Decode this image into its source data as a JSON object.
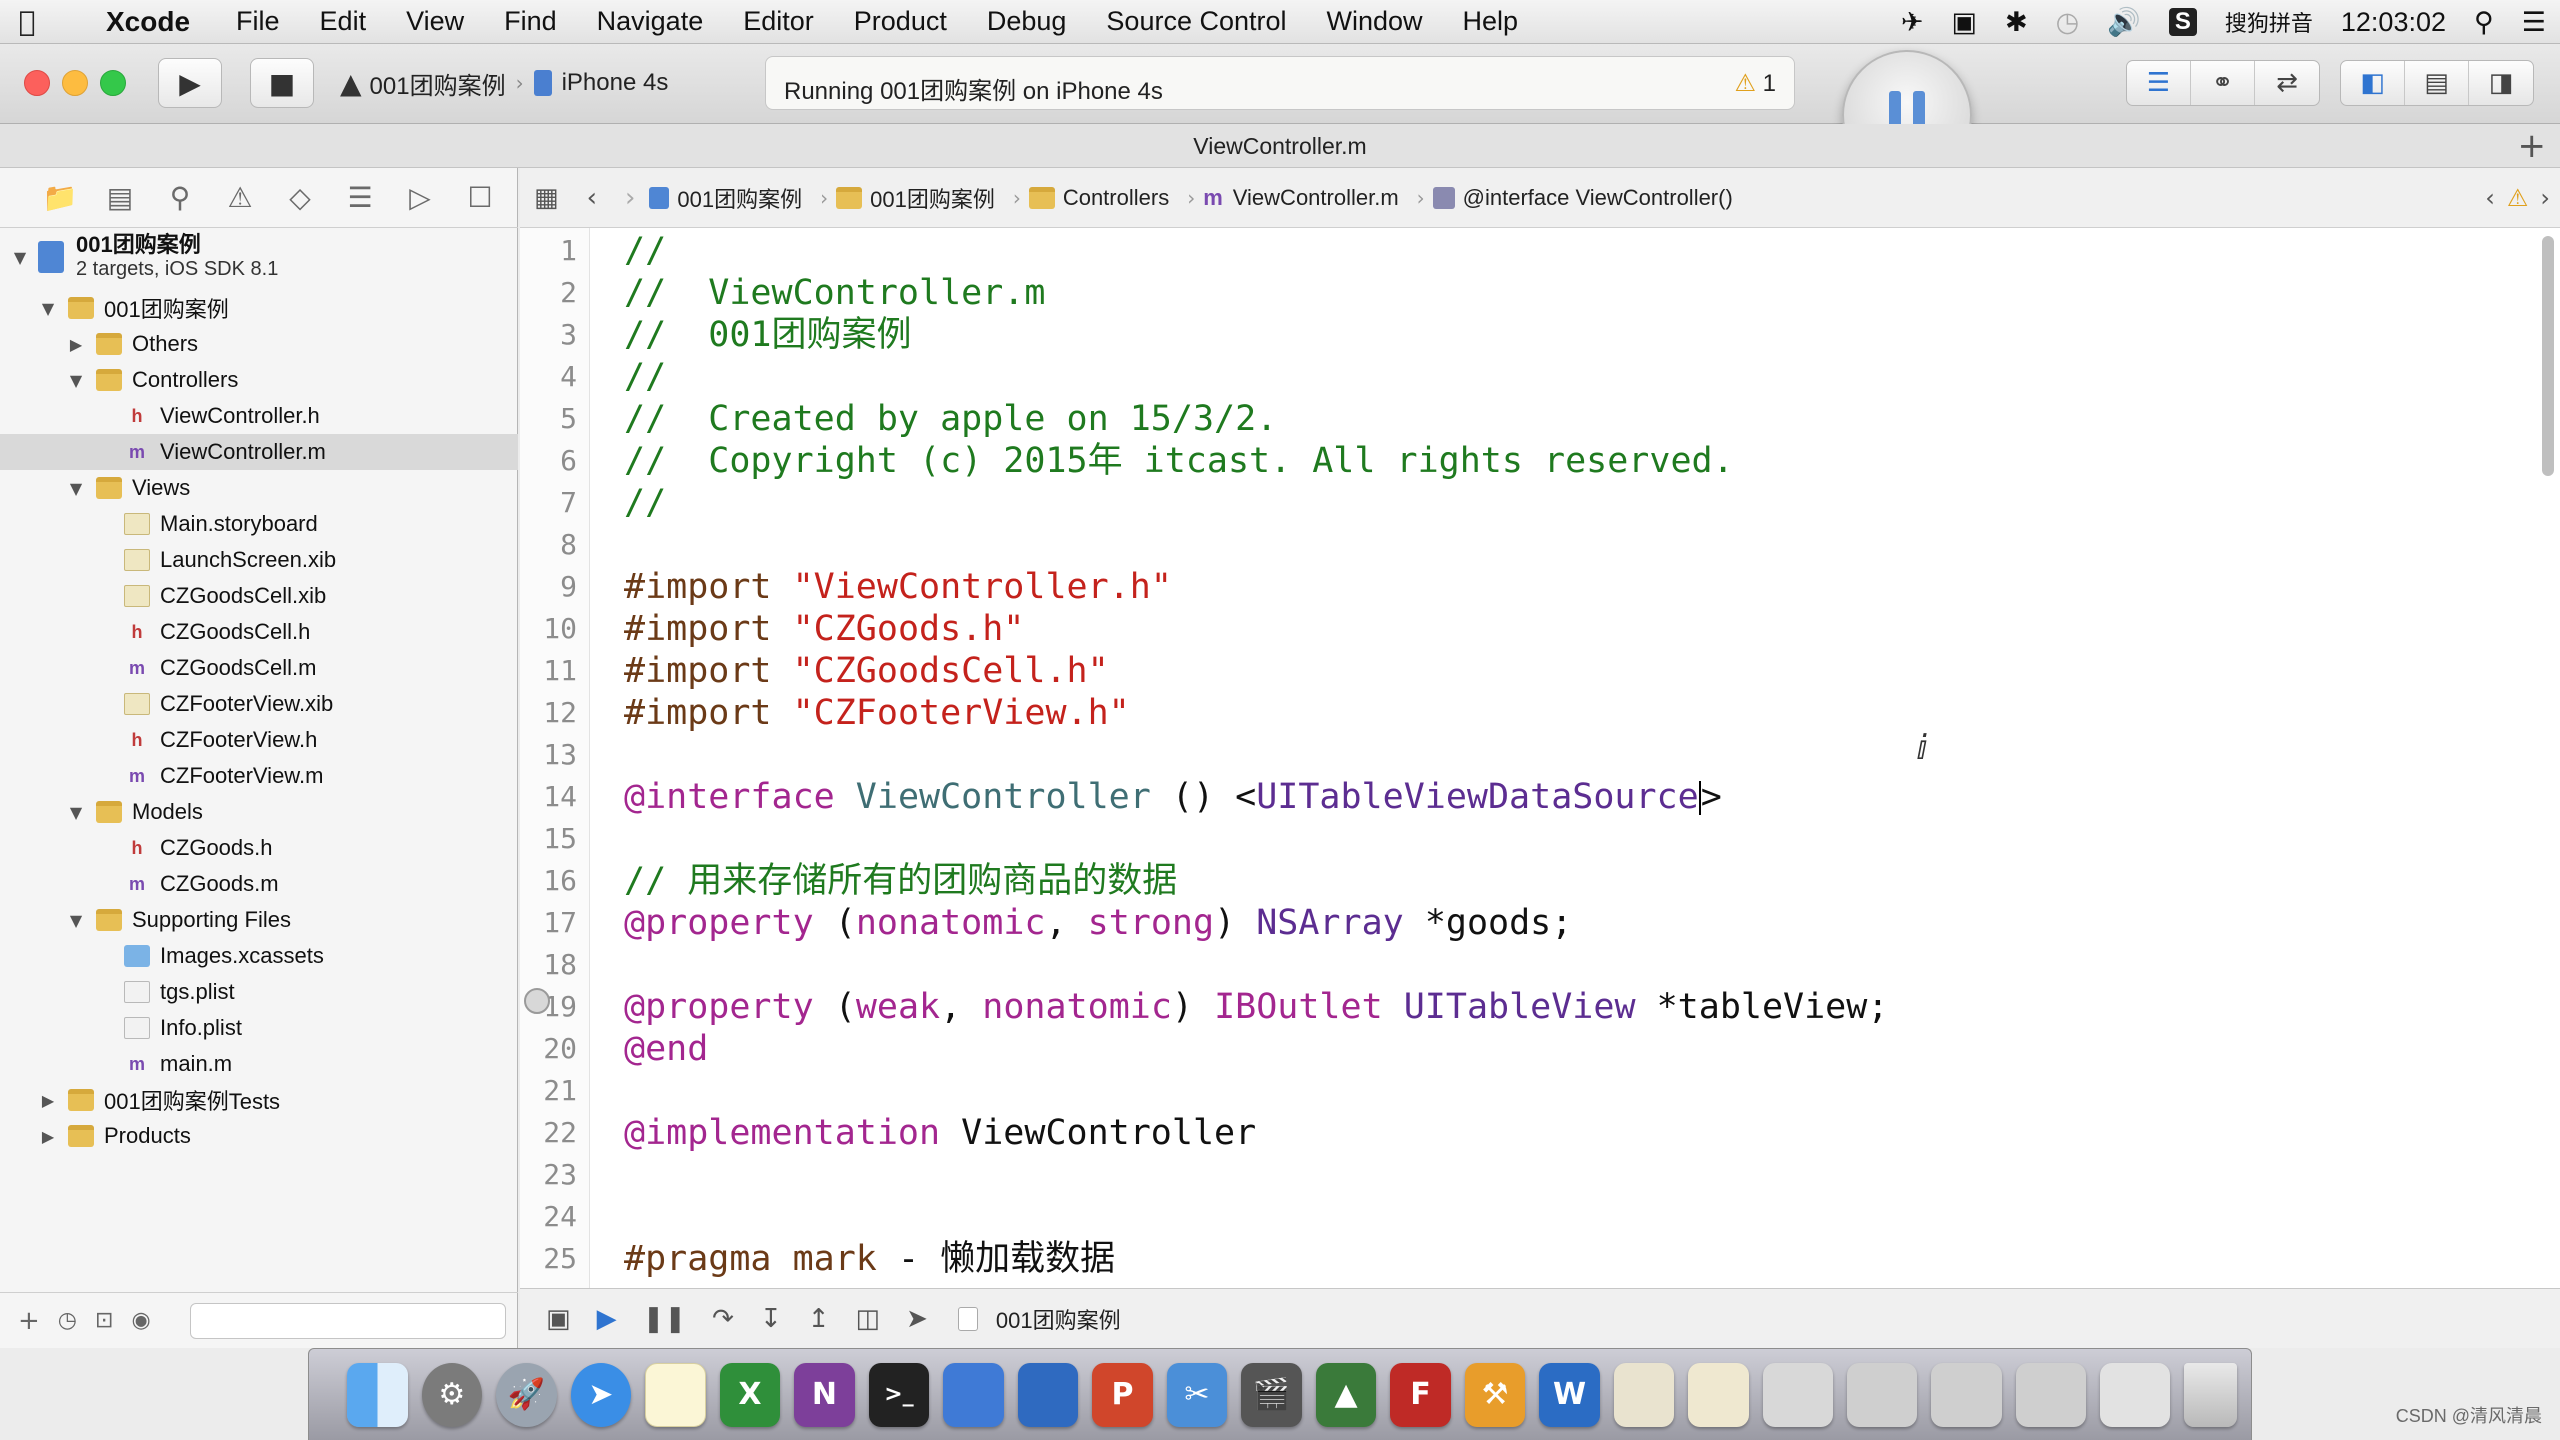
{
  "menubar": {
    "app_name": "Xcode",
    "items": [
      "File",
      "Edit",
      "View",
      "Find",
      "Navigate",
      "Editor",
      "Product",
      "Debug",
      "Source Control",
      "Window",
      "Help"
    ],
    "input_method": "搜狗拼音",
    "clock": "12:03:02"
  },
  "toolbar": {
    "scheme": "001团购案例",
    "device": "iPhone 4s",
    "activity_text": "Running 001团购案例 on iPhone 4s",
    "warning_count": "1",
    "colors": {
      "close": "#fc605c",
      "minimize": "#fdbc40",
      "zoom": "#34c84a"
    }
  },
  "window": {
    "title": "ViewController.m"
  },
  "navigator": {
    "project": {
      "name": "001团购案例",
      "subtitle": "2 targets, iOS SDK 8.1"
    },
    "rows": [
      {
        "label": "001团购案例",
        "icon": "folder"
      },
      {
        "label": "Others",
        "icon": "folder"
      },
      {
        "label": "Controllers",
        "icon": "folder"
      },
      {
        "label": "ViewController.h",
        "icon": "h"
      },
      {
        "label": "ViewController.m",
        "icon": "m"
      },
      {
        "label": "Views",
        "icon": "folder"
      },
      {
        "label": "Main.storyboard",
        "icon": "xib"
      },
      {
        "label": "LaunchScreen.xib",
        "icon": "xib"
      },
      {
        "label": "CZGoodsCell.xib",
        "icon": "xib"
      },
      {
        "label": "CZGoodsCell.h",
        "icon": "h"
      },
      {
        "label": "CZGoodsCell.m",
        "icon": "m"
      },
      {
        "label": "CZFooterView.xib",
        "icon": "xib"
      },
      {
        "label": "CZFooterView.h",
        "icon": "h"
      },
      {
        "label": "CZFooterView.m",
        "icon": "m"
      },
      {
        "label": "Models",
        "icon": "folder"
      },
      {
        "label": "CZGoods.h",
        "icon": "h"
      },
      {
        "label": "CZGoods.m",
        "icon": "m"
      },
      {
        "label": "Supporting Files",
        "icon": "folder"
      },
      {
        "label": "Images.xcassets",
        "icon": "xcassets"
      },
      {
        "label": "tgs.plist",
        "icon": "plist"
      },
      {
        "label": "Info.plist",
        "icon": "plist"
      },
      {
        "label": "main.m",
        "icon": "m"
      },
      {
        "label": "001团购案例Tests",
        "icon": "folder"
      },
      {
        "label": "Products",
        "icon": "folder"
      }
    ],
    "icon_letters": {
      "h": "h",
      "m": "m"
    }
  },
  "jumpbar": {
    "crumbs": [
      "001团购案例",
      "001团购案例",
      "Controllers",
      "ViewController.m",
      "@interface ViewController()"
    ],
    "m_letter": "m"
  },
  "editor": {
    "line_numbers": [
      "1",
      "2",
      "3",
      "4",
      "5",
      "6",
      "7",
      "8",
      "9",
      "10",
      "11",
      "12",
      "13",
      "14",
      "15",
      "16",
      "17",
      "18",
      "19",
      "20",
      "21",
      "22",
      "23",
      "24",
      "25"
    ],
    "lines": {
      "l1": "//",
      "l2": "//  ViewController.m",
      "l3": "//  001团购案例",
      "l4": "//",
      "l5": "//  Created by apple on 15/3/2.",
      "l6": "//  Copyright (c) 2015年 itcast. All rights reserved.",
      "l7": "//",
      "l9_kw": "#import",
      "l9_str": "\"ViewController.h\"",
      "l10_kw": "#import",
      "l10_str": "\"CZGoods.h\"",
      "l11_kw": "#import",
      "l11_str": "\"CZGoodsCell.h\"",
      "l12_kw": "#import",
      "l12_str": "\"CZFooterView.h\"",
      "l14_kw": "@interface",
      "l14_cls": "ViewController",
      "l14_mid": "() <",
      "l14_proto": "UITableViewDataSource",
      "l14_end": ">",
      "l16": "// 用来存储所有的团购商品的数据",
      "l17_kw": "@property",
      "l17_p1": "(",
      "l17_a1": "nonatomic",
      "l17_c": ",",
      "l17_a2": "strong",
      "l17_p2": ")",
      "l17_type": "NSArray",
      "l17_var": "*goods;",
      "l19_kw": "@property",
      "l19_p1": "(",
      "l19_a1": "weak",
      "l19_c": ",",
      "l19_a2": "nonatomic",
      "l19_p2": ")",
      "l19_outlet": "IBOutlet",
      "l19_type": "UITableView",
      "l19_var": "*tableView;",
      "l20": "@end",
      "l22_kw": "@implementation",
      "l22_cls": "ViewController",
      "l25_kw": "#pragma mark",
      "l25_rest": "- 懒加载数据"
    }
  },
  "debugbar": {
    "target": "001团购案例"
  },
  "watermark": "CSDN @清风清晨"
}
